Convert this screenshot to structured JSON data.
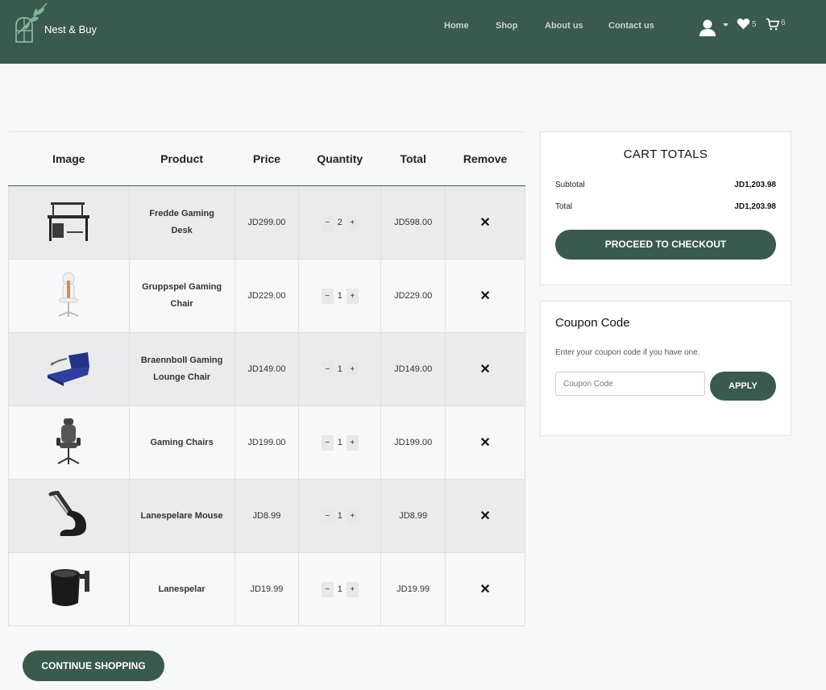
{
  "header": {
    "brand": "Nest & Buy",
    "nav": [
      "Home",
      "Shop",
      "About us",
      "Contact us"
    ],
    "wishlist_count": "5",
    "cart_count": "6"
  },
  "table": {
    "headers": [
      "Image",
      "Product",
      "Price",
      "Quantity",
      "Total",
      "Remove"
    ],
    "rows": [
      {
        "name": "Fredde Gaming Desk",
        "price": "JD299.00",
        "qty": "2",
        "total": "JD598.00",
        "remove": "✕",
        "image": "desk"
      },
      {
        "name": "Gruppspel Gaming Chair",
        "price": "JD229.00",
        "qty": "1",
        "total": "JD229.00",
        "remove": "✕",
        "image": "white-chair"
      },
      {
        "name": "Braennboll Gaming Lounge Chair",
        "price": "JD149.00",
        "qty": "1",
        "total": "JD149.00",
        "remove": "✕",
        "image": "blue-lounge"
      },
      {
        "name": "Gaming Chairs",
        "price": "JD199.00",
        "qty": "1",
        "total": "JD199.00",
        "remove": "✕",
        "image": "grey-chair"
      },
      {
        "name": "Lanespelare Mouse",
        "price": "JD8.99",
        "qty": "1",
        "total": "JD8.99",
        "remove": "✕",
        "image": "mouse-bungee"
      },
      {
        "name": "Lanespelar",
        "price": "JD19.99",
        "qty": "1",
        "total": "JD19.99",
        "remove": "✕",
        "image": "cup-holder"
      }
    ],
    "qty_minus": "−",
    "qty_plus": "+"
  },
  "continue_label": "CONTINUE SHOPPING",
  "totals": {
    "title": "CART TOTALS",
    "subtotal_label": "Subtotal",
    "subtotal_value": "JD1,203.98",
    "total_label": "Total",
    "total_value": "JD1,203.98",
    "checkout_label": "PROCEED TO CHECKOUT"
  },
  "coupon": {
    "title": "Coupon Code",
    "hint": "Enter your coupon code if you have one.",
    "placeholder": "Coupon Code",
    "apply_label": "APPLY"
  },
  "colors": {
    "brand": "#3a5a4b",
    "background": "#f7f8fa"
  }
}
